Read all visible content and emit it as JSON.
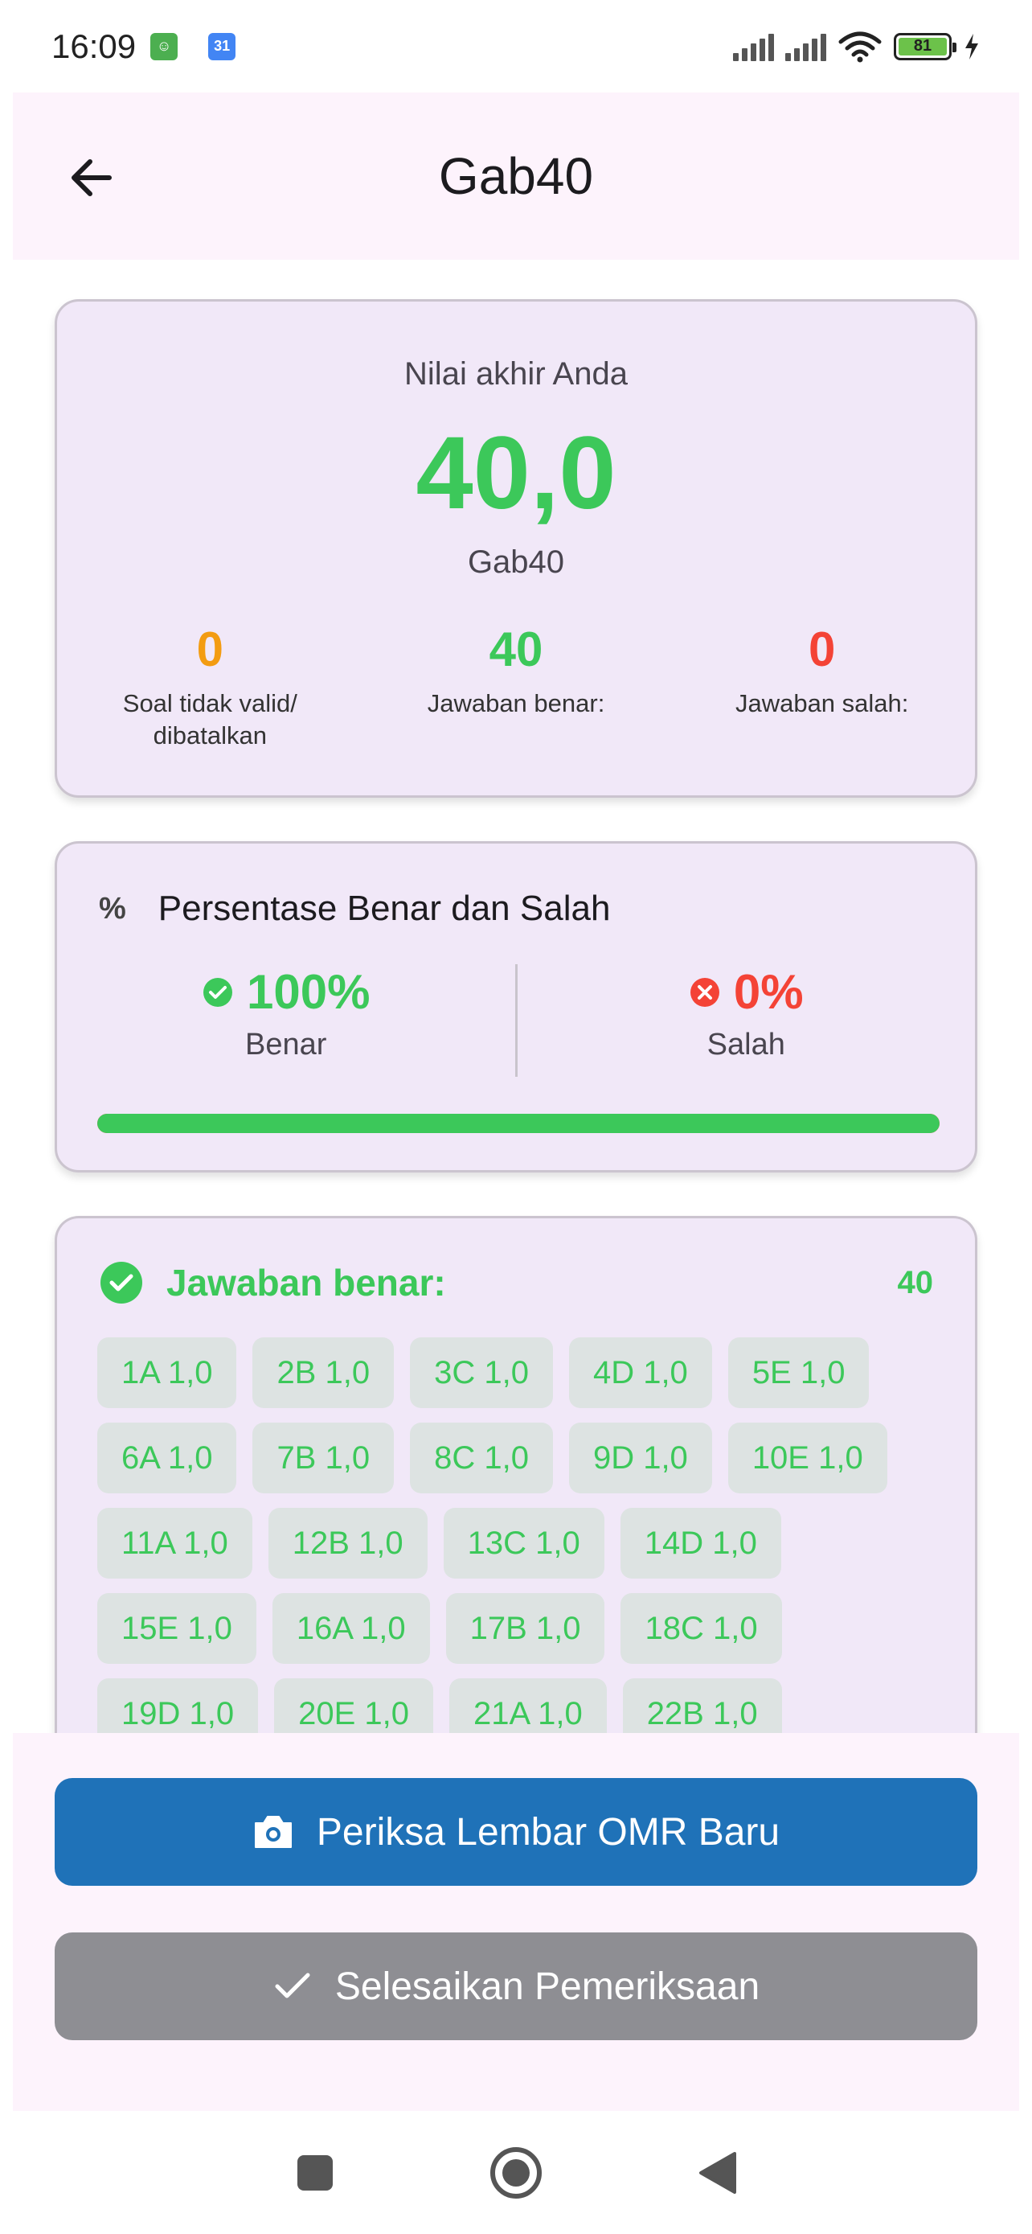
{
  "status_bar": {
    "time": "16:09",
    "battery": "81"
  },
  "app_bar": {
    "title": "Gab40",
    "back_icon": "arrow-back-icon"
  },
  "score_card": {
    "label": "Nilai akhir Anda",
    "score": "40,0",
    "exam_name": "Gab40",
    "stats": [
      {
        "value": "0",
        "label": "Soal tidak valid/ dibatalkan",
        "color": "#f39c12"
      },
      {
        "value": "40",
        "label": "Jawaban benar:",
        "color": "#3cc85a"
      },
      {
        "value": "0",
        "label": "Jawaban salah:",
        "color": "#f44336"
      }
    ]
  },
  "percentage_card": {
    "icon": "%",
    "title": "Persentase Benar dan Salah",
    "correct": {
      "value": "100%",
      "label": "Benar",
      "color": "#3cc85a"
    },
    "wrong": {
      "value": "0%",
      "label": "Salah",
      "color": "#f44336"
    },
    "correct_fraction": 1.0
  },
  "answers_card": {
    "title": "Jawaban benar:",
    "count": "40",
    "items": [
      "1A 1,0",
      "2B 1,0",
      "3C 1,0",
      "4D 1,0",
      "5E 1,0",
      "6A 1,0",
      "7B 1,0",
      "8C 1,0",
      "9D 1,0",
      "10E 1,0",
      "11A 1,0",
      "12B 1,0",
      "13C 1,0",
      "14D 1,0",
      "15E 1,0",
      "16A 1,0",
      "17B 1,0",
      "18C 1,0",
      "19D 1,0",
      "20E 1,0",
      "21A 1,0",
      "22B 1,0"
    ]
  },
  "actions": {
    "scan_label": "Periksa Lembar OMR Baru",
    "finish_label": "Selesaikan Pemeriksaan"
  },
  "colors": {
    "green": "#3cc85a",
    "orange": "#f39c12",
    "red": "#f44336",
    "primary": "#1f72b8"
  }
}
